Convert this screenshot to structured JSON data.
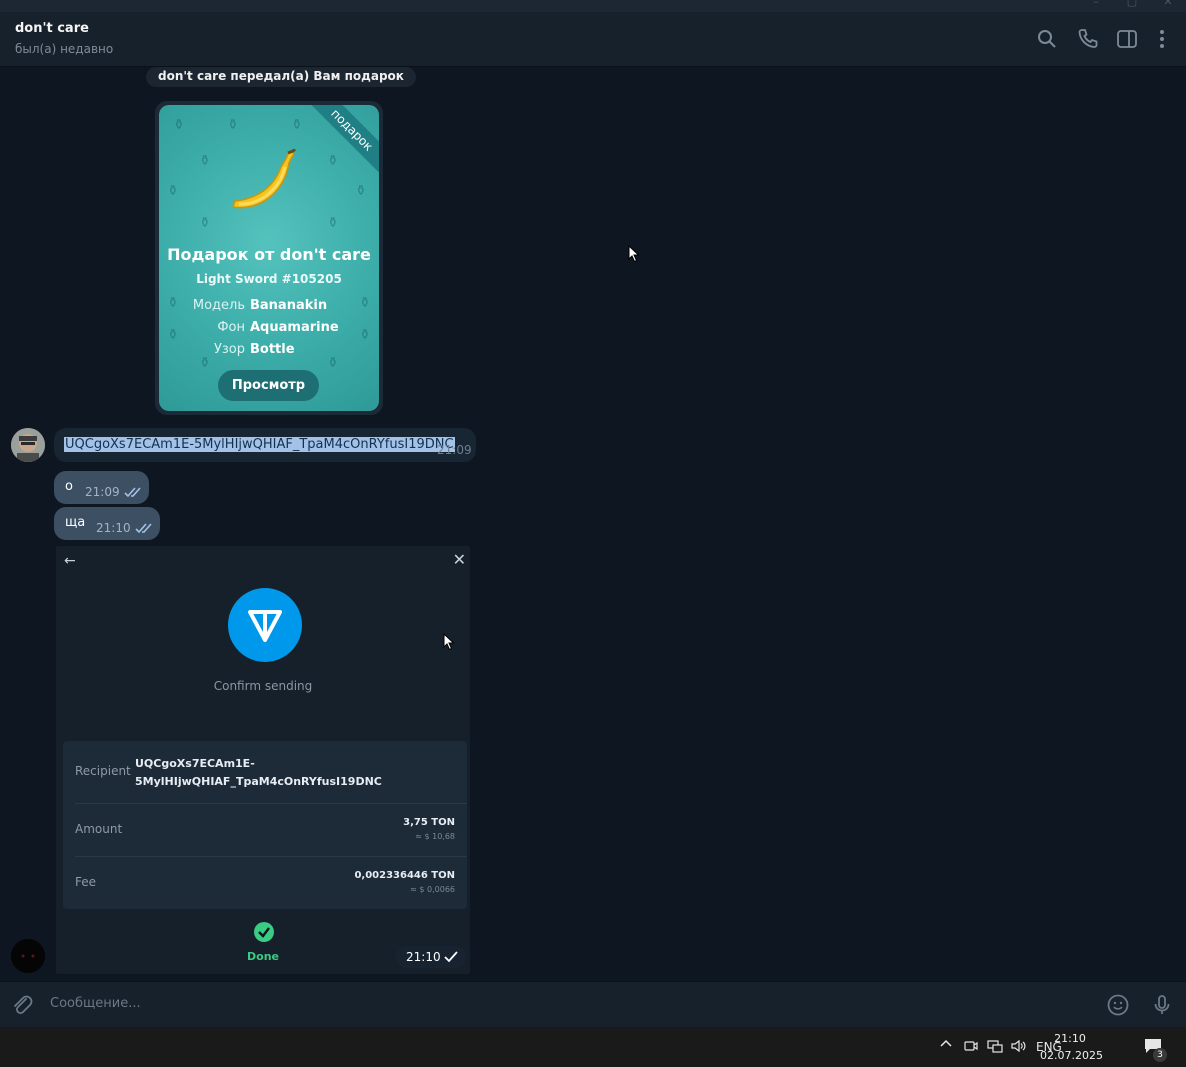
{
  "header": {
    "title": "don't care",
    "status": "был(а) недавно",
    "icons": [
      "search-icon",
      "phone-icon",
      "sidebar-toggle-icon",
      "more-icon"
    ]
  },
  "service_message": "don't care передал(а) Вам подарок",
  "gift": {
    "ribbon": "подарок",
    "title": "Подарок от don't care",
    "subtitle": "Light Sword #105205",
    "attributes": [
      {
        "key": "Модель",
        "value": "Bananakin"
      },
      {
        "key": "Фон",
        "value": "Aquamarine"
      },
      {
        "key": "Узор",
        "value": "Bottle"
      }
    ],
    "button": "Просмотр"
  },
  "messages": [
    {
      "text": "UQCgoXs7ECAm1E-5MylHIjwQHIAF_TpaM4cOnRYfusI19DNC",
      "time": "21:09",
      "direction": "in"
    },
    {
      "text": "о",
      "time": "21:09",
      "direction": "out"
    },
    {
      "text": "ща",
      "time": "21:10",
      "direction": "out"
    }
  ],
  "wallet_screenshot": {
    "confirm_text": "Confirm sending",
    "rows": {
      "recipient_label": "Recipient",
      "recipient_line1": "UQCgoXs7ECAm1E-",
      "recipient_line2": "5MylHIjwQHIAF_TpaM4cOnRYfusI19DNC",
      "amount_label": "Amount",
      "amount_value": "3,75  TON",
      "amount_fiat": "≈ $ 10,68",
      "fee_label": "Fee",
      "fee_value": "0,002336446  TON",
      "fee_fiat": "≈ $ 0,0066"
    },
    "done_label": "Done",
    "time": "21:10"
  },
  "composer": {
    "placeholder": "Сообщение..."
  },
  "taskbar": {
    "language": "ENG",
    "time": "21:10",
    "date": "02.07.2025",
    "notifications": "3"
  },
  "colors": {
    "chat_bg": "#0e1621",
    "outgoing_bubble": "#2b5278",
    "incoming_bubble": "#182533",
    "gift_bg": "#3fb0ac",
    "ton_blue": "#0098ea",
    "done_green": "#39cc83"
  }
}
